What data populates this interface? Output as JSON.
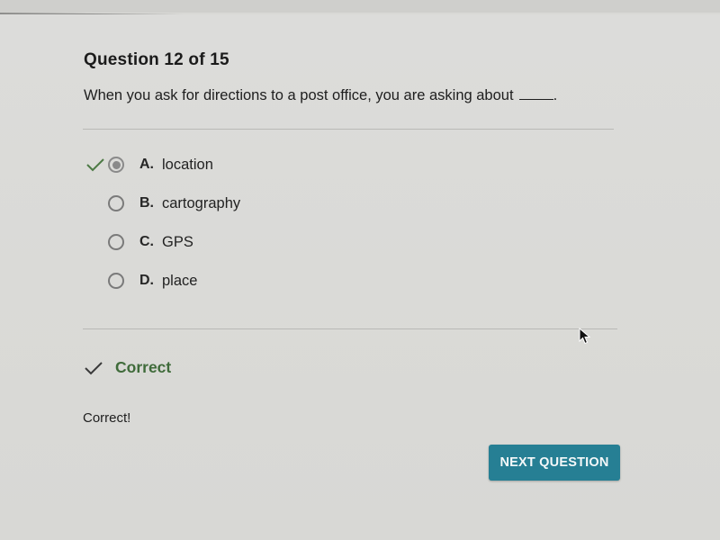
{
  "quiz": {
    "question_counter": "Question 12 of 15",
    "question_text": "When you ask for directions to a post office, you are asking about",
    "options": [
      {
        "letter": "A.",
        "text": "location",
        "selected": true,
        "correct": true
      },
      {
        "letter": "B.",
        "text": "cartography",
        "selected": false,
        "correct": false
      },
      {
        "letter": "C.",
        "text": "GPS",
        "selected": false,
        "correct": false
      },
      {
        "letter": "D.",
        "text": "place",
        "selected": false,
        "correct": false
      }
    ]
  },
  "feedback": {
    "icon": "check-icon",
    "title": "Correct",
    "body": "Correct!"
  },
  "actions": {
    "next_label": "NEXT QUESTION"
  },
  "colors": {
    "correct_green": "#3f6b3a",
    "button_teal": "#267f94"
  }
}
